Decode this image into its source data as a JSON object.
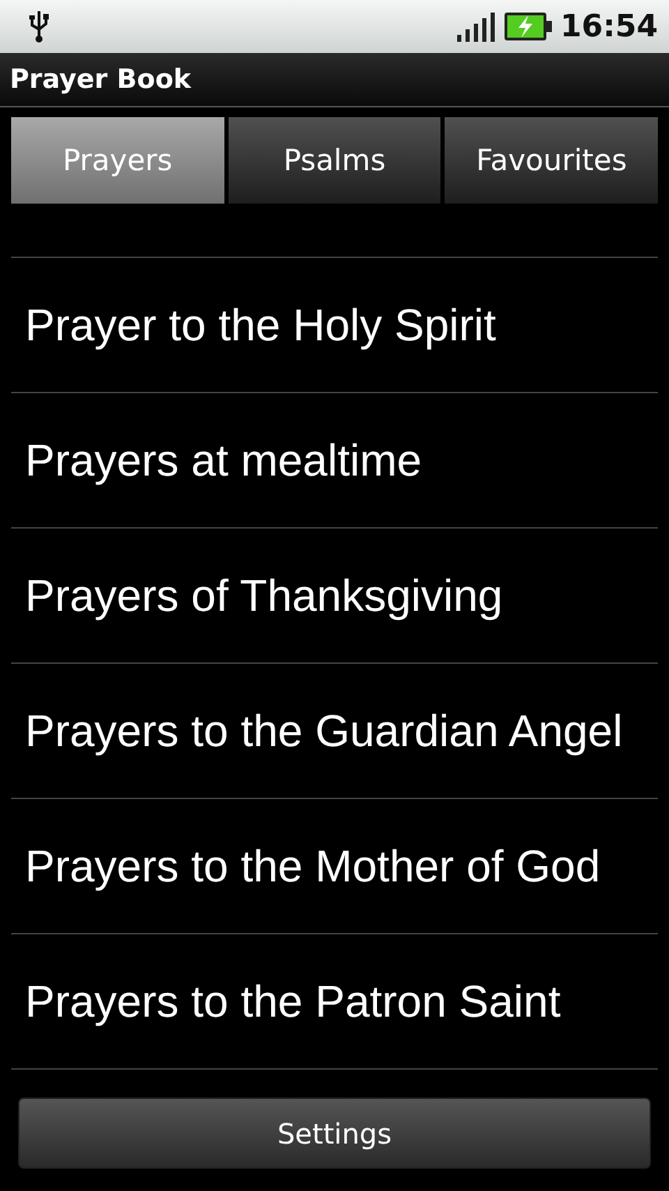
{
  "status_bar": {
    "time": "16:54"
  },
  "window": {
    "title": "Prayer Book"
  },
  "tabs": [
    {
      "label": "Prayers",
      "selected": true
    },
    {
      "label": "Psalms",
      "selected": false
    },
    {
      "label": "Favourites",
      "selected": false
    }
  ],
  "list": {
    "items": [
      "Prayer to the Holy Spirit",
      "Prayers at mealtime",
      "Prayers of Thanksgiving",
      "Prayers to the Guardian Angel",
      "Prayers to the Mother of God",
      "Prayers to the Patron Saint"
    ]
  },
  "buttons": [
    "Settings"
  ]
}
